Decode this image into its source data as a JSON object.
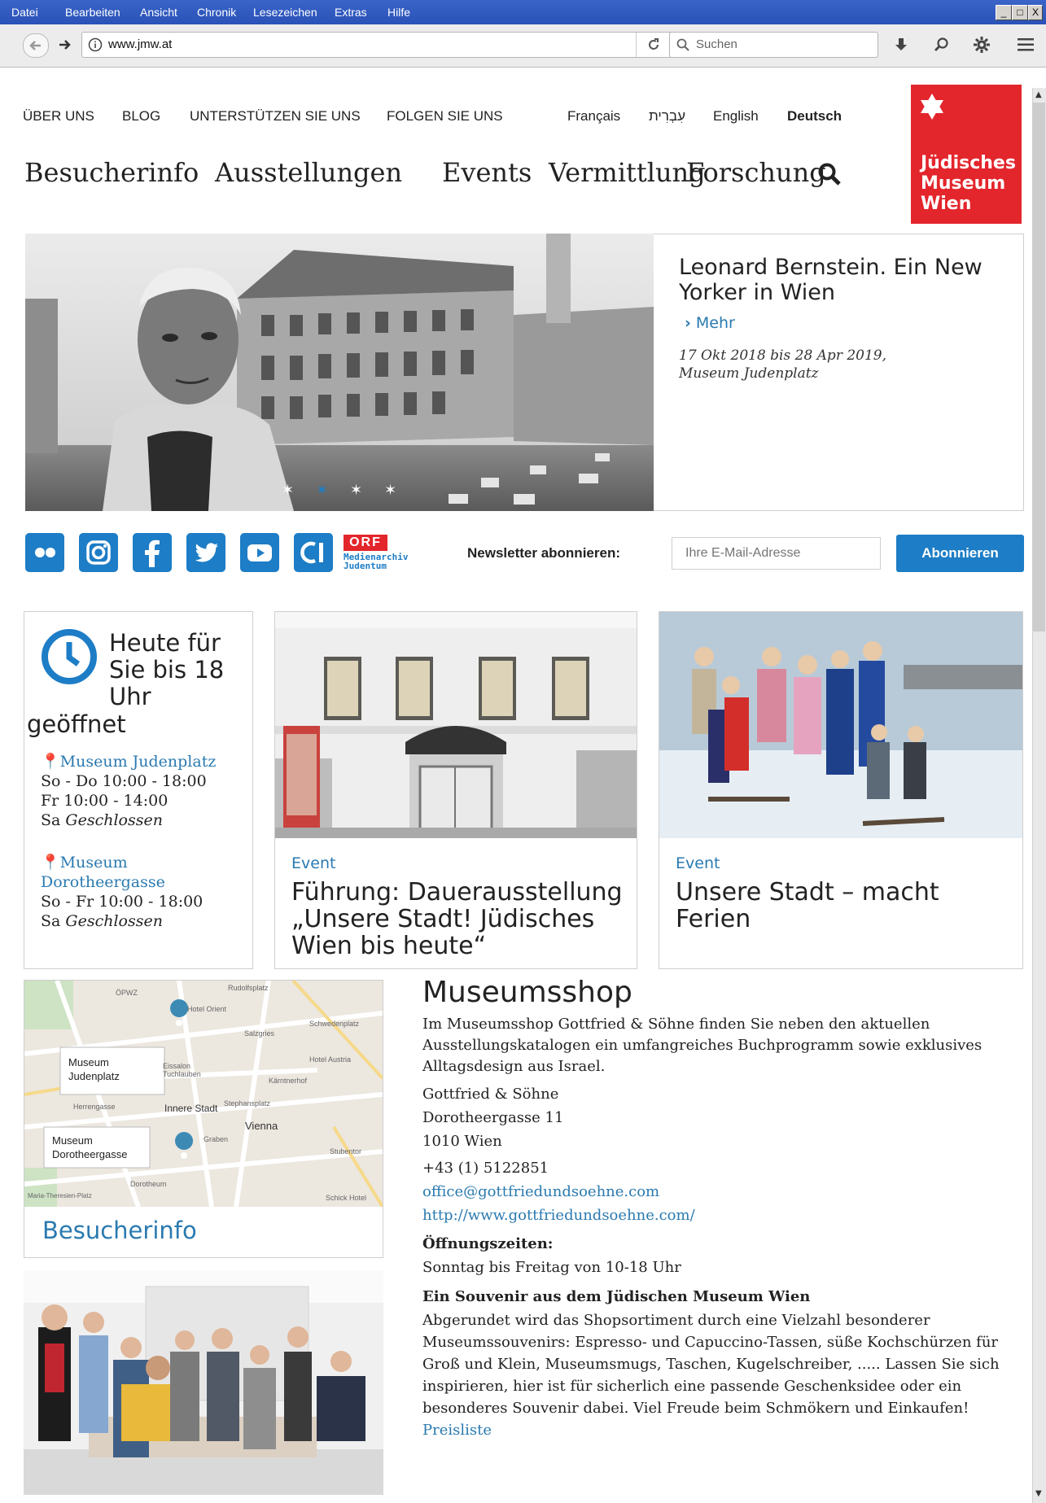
{
  "window": {
    "menu": [
      "Datei",
      "Bearbeiten",
      "Ansicht",
      "Chronik",
      "Lesezeichen",
      "Extras",
      "Hilfe"
    ],
    "controls": [
      "_",
      "□",
      "X"
    ]
  },
  "browser": {
    "url": "www.jmw.at",
    "search_placeholder": "Suchen"
  },
  "header": {
    "topnav": [
      "ÜBER UNS",
      "BLOG",
      "UNTERSTÜTZEN SIE UNS",
      "FOLGEN SIE UNS"
    ],
    "languages": [
      "Français",
      "עִבְרִית",
      "English",
      "Deutsch"
    ],
    "active_language": "Deutsch",
    "mainnav": [
      "Besucherinfo",
      "Ausstellungen",
      "Events",
      "Vermittlung",
      "Forschung"
    ],
    "logo": {
      "line1": "Jüdisches",
      "line2": "Museum",
      "line3": "Wien",
      "color": "#e3262c"
    }
  },
  "hero": {
    "title": "Leonard Bernstein. Ein New Yorker in Wien",
    "more": "Mehr",
    "dates": "17 Okt 2018 bis 28 Apr 2019,",
    "location": "Museum Judenplatz",
    "slides": 4,
    "active_slide": 2
  },
  "social": {
    "icons": [
      "flickr-icon",
      "instagram-icon",
      "facebook-icon",
      "twitter-icon",
      "youtube-icon",
      "ci-icon"
    ],
    "orf_badge": "ORF",
    "orf_line1": "Medienarchiv",
    "orf_line2": "Judentum",
    "newsletter_label": "Newsletter abonnieren:",
    "email_placeholder": "Ihre E-Mail-Adresse",
    "subscribe_button": "Abonnieren",
    "accent": "#1d7dc6"
  },
  "hours": {
    "title_line1": "Heute für",
    "title_line2": "Sie bis 18",
    "title_line3": "Uhr",
    "title_line4": "geöffnet",
    "judenplatz": {
      "name": "Museum Judenplatz",
      "line1": "So - Do 10:00 - 18:00",
      "line2": "Fr 10:00 - 14:00",
      "line3_day": "Sa",
      "line3_status": "Geschlossen"
    },
    "dorotheergasse": {
      "name_line1": "Museum",
      "name_line2": "Dorotheergasse",
      "line1": "So - Fr 10:00 - 18:00",
      "line2_day": "Sa",
      "line2_status": "Geschlossen"
    }
  },
  "events": [
    {
      "label": "Event",
      "title": "Führung: Dauerausstellung „Unsere Stadt! Jüdisches Wien bis heute“"
    },
    {
      "label": "Event",
      "title": "Unsere Stadt – macht Ferien"
    }
  ],
  "map": {
    "labels": [
      "Museum Judenplatz",
      "Museum Dorotheergasse",
      "Innere Stadt",
      "Vienna",
      "Hotel Orient",
      "Graben",
      "Dorotheum",
      "Hotel Austria",
      "Schwedenplatz",
      "Stephansplatz",
      "Herrengasse",
      "Kärntnerhof",
      "Eissalon Tuchlauben",
      "ÖPWZ",
      "Rudolfsplatz",
      "Maria-Theresien-Platz",
      "Salzgries",
      "Stubentor",
      "Schick Hotel"
    ],
    "caption": "Besucherinfo"
  },
  "shop": {
    "title": "Museumsshop",
    "intro": "Im Museumsshop Gottfried & Söhne finden Sie neben den aktuellen Ausstellungskatalogen ein umfangreiches Buchprogramm sowie exklusives Alltagsdesign aus Israel.",
    "addr1": "Gottfried & Söhne",
    "addr2": "Dorotheergasse 11",
    "addr3": "1010 Wien",
    "phone": "+43 (1) 5122851",
    "email": "office@gottfriedundsoehne.com",
    "web": "http://www.gottfriedundsoehne.com/",
    "hours_title": "Öffnungszeiten:",
    "hours_text": "Sonntag bis Freitag von 10-18 Uhr",
    "souvenir_title": "Ein Souvenir aus dem Jüdischen Museum Wien",
    "souvenir_text": "Abgerundet wird das Shopsortiment durch eine Vielzahl besonderer Museumssouvenirs: Espresso- und Capuccino-Tassen, süße Kochschürzen für Groß und Klein, Museumsmugs, Taschen,  Kugelschreiber, ..... Lassen Sie sich inspirieren, hier ist für sicherlich eine passende Geschenksidee oder ein besonderes Souvenir dabei.  Viel Freude beim  Schmökern und Einkaufen!",
    "pricelist": "Preisliste"
  }
}
